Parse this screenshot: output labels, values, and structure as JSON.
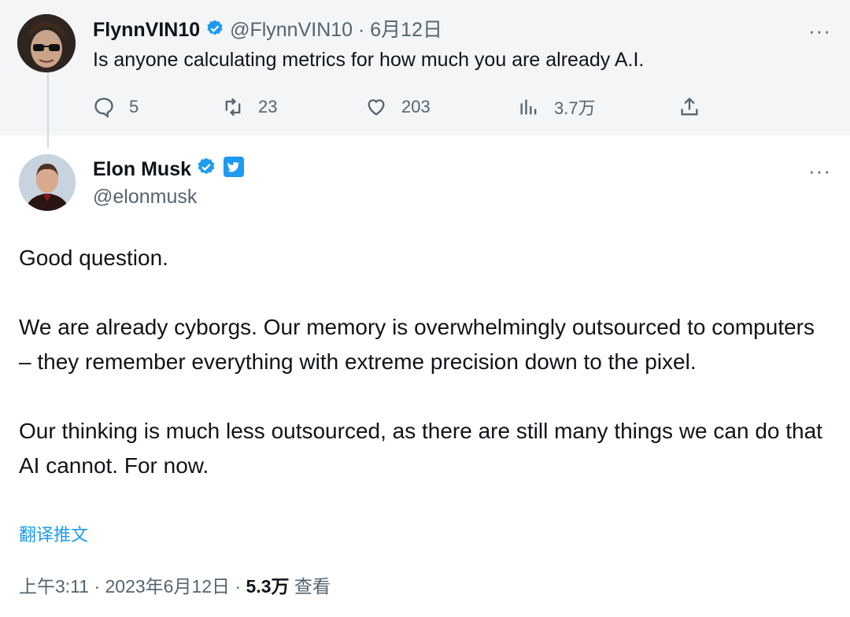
{
  "reply": {
    "display_name": "FlynnVIN10",
    "handle": "@FlynnVIN10",
    "separator": " · ",
    "date": "6月12日",
    "text": "Is anyone calculating metrics for how much you are already A.I.",
    "more_icon": "···",
    "actions": {
      "replies": "5",
      "retweets": "23",
      "likes": "203",
      "views": "3.7万"
    }
  },
  "main": {
    "display_name": "Elon Musk",
    "handle": "@elonmusk",
    "more_icon": "···",
    "paragraphs": [
      "Good question.",
      "We are already cyborgs. Our memory is overwhelmingly outsourced to computers – they remember everything with extreme precision down to the pixel.",
      "Our thinking is much less outsourced, as there are still many things we can do that AI cannot. For now."
    ],
    "translate_label": "翻译推文",
    "time": "上午3:11",
    "date": "2023年6月12日",
    "meta_sep": " · ",
    "views_count": "5.3万",
    "views_label": " 查看"
  },
  "colors": {
    "verified_blue": "#1d9bf0",
    "muted": "#536471",
    "link": "#1d9bf0"
  }
}
